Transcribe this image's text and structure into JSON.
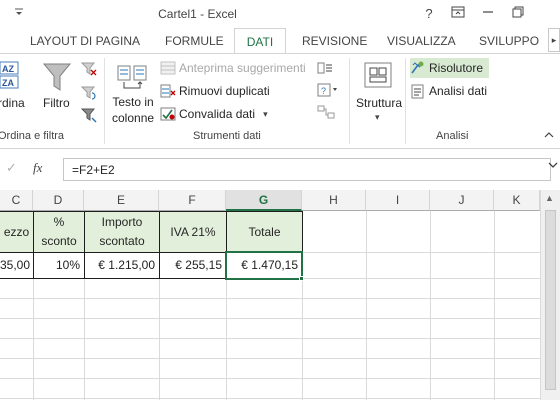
{
  "window": {
    "title": "Cartel1 - Excel",
    "qat_icon": "customize-qat-arrow",
    "buttons": {
      "help": "?",
      "ribbon_options": "⧉",
      "minimize": "—",
      "restore": "❐"
    }
  },
  "tabs": [
    {
      "label": "LAYOUT DI PAGINA",
      "active": false
    },
    {
      "label": "FORMULE",
      "active": false
    },
    {
      "label": "DATI",
      "active": true
    },
    {
      "label": "REVISIONE",
      "active": false
    },
    {
      "label": "VISUALIZZA",
      "active": false
    },
    {
      "label": "SVILUPPO",
      "active": false
    }
  ],
  "ribbon": {
    "sort_filter": {
      "sort_label": "rdina",
      "filter_label": "Filtro",
      "group_label": "Ordina e filtra"
    },
    "data_tools": {
      "text_to_columns_line1": "Testo in",
      "text_to_columns_line2": "colonne",
      "flash_fill": "Anteprima suggerimenti",
      "remove_duplicates": "Rimuovi duplicati",
      "data_validation": "Convalida dati",
      "group_label": "Strumenti dati"
    },
    "outline": {
      "label": "Struttura"
    },
    "analysis": {
      "solver": "Risolutore",
      "data_analysis": "Analisi dati",
      "group_label": "Analisi"
    }
  },
  "formula_bar": {
    "cancel_icon": "✓",
    "fx": "fx",
    "formula": "=F2+E2"
  },
  "columns": [
    "C",
    "D",
    "E",
    "F",
    "G",
    "H",
    "I",
    "J",
    "K"
  ],
  "selected_column": "G",
  "table": {
    "headers": {
      "c": "ezzo",
      "d_line1": "%",
      "d_line2": "sconto",
      "e_line1": "Importo",
      "e_line2": "scontato",
      "f": "IVA 21%",
      "g": "Totale"
    },
    "row": {
      "c": "35,00",
      "d": "10%",
      "e": "€ 1.215,00",
      "f": "€ 255,15",
      "g": "€ 1.470,15"
    }
  },
  "colors": {
    "accent": "#217346",
    "header_fill": "#e2efda"
  }
}
